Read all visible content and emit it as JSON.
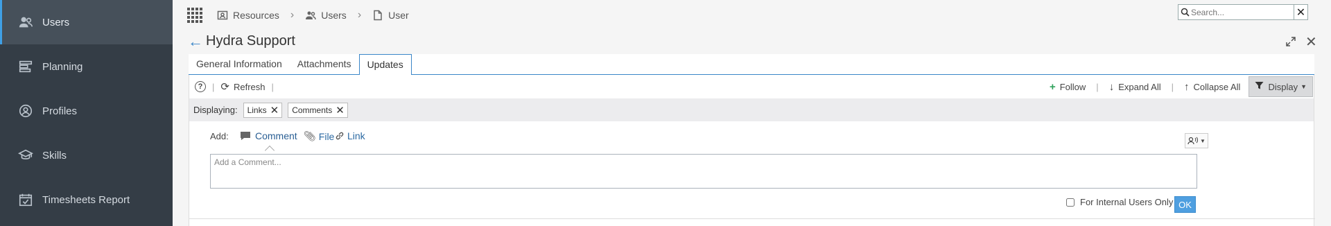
{
  "sidebar": {
    "items": [
      {
        "label": "Users",
        "icon": "users-icon",
        "active": true
      },
      {
        "label": "Planning",
        "icon": "planning-icon"
      },
      {
        "label": "Profiles",
        "icon": "profile-icon"
      },
      {
        "label": "Skills",
        "icon": "skills-icon"
      },
      {
        "label": "Timesheets Report",
        "icon": "calendar-check-icon"
      }
    ]
  },
  "breadcrumb": [
    "Resources",
    "Users",
    "User"
  ],
  "search": {
    "placeholder": "Search...",
    "value": ""
  },
  "page": {
    "title": "Hydra Support"
  },
  "tabs": [
    {
      "label": "General Information"
    },
    {
      "label": "Attachments"
    },
    {
      "label": "Updates",
      "active": true
    }
  ],
  "toolbar": {
    "help": "?",
    "refresh": "Refresh",
    "follow": "Follow",
    "expand_all": "Expand All",
    "collapse_all": "Collapse All",
    "display": "Display"
  },
  "filters": {
    "label": "Displaying:",
    "chips": [
      "Links",
      "Comments"
    ]
  },
  "add": {
    "label": "Add:",
    "comment": "Comment",
    "file": "File",
    "link": "Link"
  },
  "comment_box": {
    "placeholder": "Add a Comment...",
    "value": ""
  },
  "internal": {
    "label": "For Internal Users Only",
    "checked": false
  },
  "ok_label": "OK",
  "colors": {
    "accent": "#3a86c8",
    "sidebar": "#343d46",
    "follow": "#2fa15b",
    "ok": "#4f9fe0"
  }
}
